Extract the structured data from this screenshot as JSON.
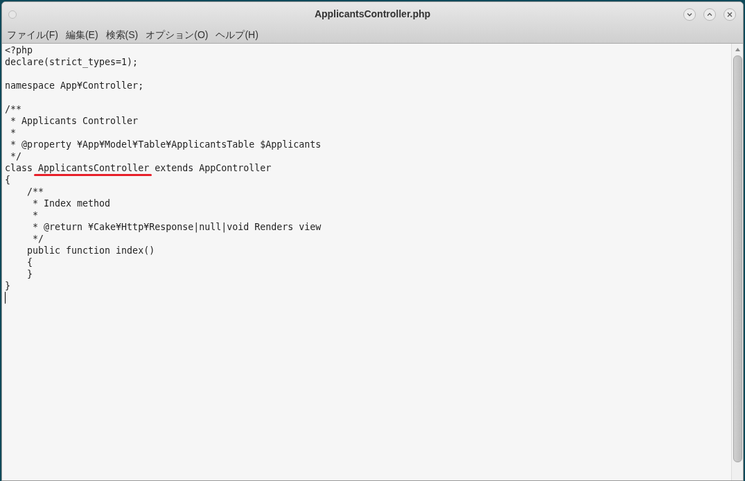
{
  "window": {
    "title": "ApplicantsController.php"
  },
  "menu": [
    {
      "label": "ファイル(F)"
    },
    {
      "label": "編集(E)"
    },
    {
      "label": "検索(S)"
    },
    {
      "label": "オプション(O)"
    },
    {
      "label": "ヘルプ(H)"
    }
  ],
  "editor": {
    "lines": [
      {
        "kind": "code",
        "text": "<?php"
      },
      {
        "kind": "code",
        "text": "declare(strict_types=1);"
      },
      {
        "kind": "blank"
      },
      {
        "kind": "code",
        "text": "namespace App¥Controller;"
      },
      {
        "kind": "blank"
      },
      {
        "kind": "code",
        "text": "/**"
      },
      {
        "kind": "code",
        "text": " * Applicants Controller"
      },
      {
        "kind": "code",
        "text": " *"
      },
      {
        "kind": "code",
        "text": " * @property ¥App¥Model¥Table¥ApplicantsTable $Applicants"
      },
      {
        "kind": "code",
        "text": " */"
      },
      {
        "kind": "parts",
        "parts": [
          {
            "text": "class ",
            "underlined": false
          },
          {
            "text": "ApplicantsController",
            "underlined": true
          },
          {
            "text": " extends AppController",
            "underlined": false
          }
        ]
      },
      {
        "kind": "code",
        "text": "{"
      },
      {
        "kind": "code",
        "text": "    /**"
      },
      {
        "kind": "code",
        "text": "     * Index method"
      },
      {
        "kind": "code",
        "text": "     *"
      },
      {
        "kind": "code",
        "text": "     * @return ¥Cake¥Http¥Response|null|void Renders view"
      },
      {
        "kind": "code",
        "text": "     */"
      },
      {
        "kind": "code",
        "text": "    public function index()"
      },
      {
        "kind": "code",
        "text": "    {"
      },
      {
        "kind": "code",
        "text": "    }"
      },
      {
        "kind": "code",
        "text": "}"
      },
      {
        "kind": "cursor"
      }
    ]
  }
}
